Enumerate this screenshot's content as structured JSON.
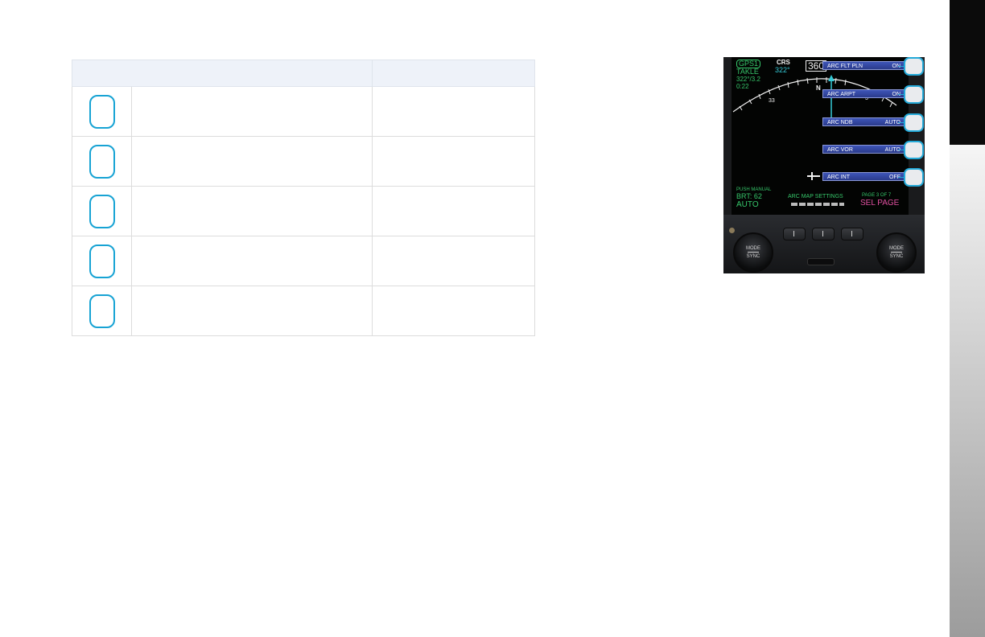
{
  "table": {
    "header": [
      "",
      "",
      ""
    ],
    "rows": [
      {
        "key": "",
        "description": "",
        "value": ""
      },
      {
        "key": "",
        "description": "",
        "value": ""
      },
      {
        "key": "",
        "description": "",
        "value": ""
      },
      {
        "key": "",
        "description": "",
        "value": ""
      },
      {
        "key": "",
        "description": "",
        "value": ""
      }
    ]
  },
  "display": {
    "nav_source": "GPS1",
    "waypoint": "TAKLE",
    "bearing_distance": "322°/3.2",
    "time": "0:22",
    "crs_label": "CRS",
    "crs_value": "322°",
    "heading_box": "360",
    "compass_33": "33",
    "compass_n": "N",
    "compass_3": "3",
    "menu": [
      {
        "label": "ARC FLT PLN",
        "value": "ON"
      },
      {
        "label": "ARC ARPT",
        "value": "ON"
      },
      {
        "label": "ARC NDB",
        "value": "AUTO"
      },
      {
        "label": "ARC VOR",
        "value": "AUTO"
      },
      {
        "label": "ARC INT",
        "value": "OFF"
      }
    ],
    "push_manual": "PUSH MANUAL",
    "brt": "BRT: 62",
    "auto": "AUTO",
    "page_title": "ARC MAP SETTINGS",
    "page_num": "PAGE 3 OF 7",
    "sel_page": "SEL PAGE",
    "knob_mode": "MODE",
    "knob_sync": "SYNC"
  },
  "colors": {
    "accent": "#17a3d4",
    "table_header": "#eef2f9",
    "screen_green": "#36c66a",
    "screen_cyan": "#35c9d6",
    "screen_magenta": "#e050a0",
    "menu_blue": "#3e55b8"
  }
}
